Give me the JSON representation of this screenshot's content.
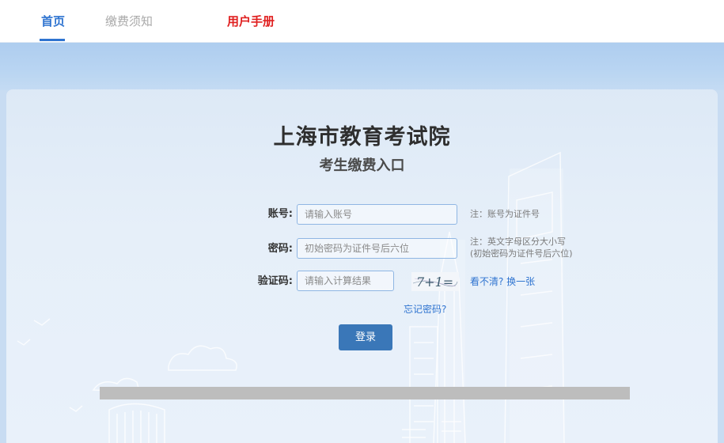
{
  "nav": {
    "items": [
      {
        "label": "首页",
        "active": true
      },
      {
        "label": "缴费须知",
        "active": false
      },
      {
        "label": "用户手册",
        "active": false
      }
    ]
  },
  "header": {
    "title": "上海市教育考试院",
    "subtitle": "考生缴费入口"
  },
  "form": {
    "account": {
      "label": "账号:",
      "placeholder": "请输入账号",
      "note": "注：账号为证件号"
    },
    "password": {
      "label": "密码:",
      "placeholder": "初始密码为证件号后六位",
      "note_line1": "注：英文字母区分大小写",
      "note_line2": "(初始密码为证件号后六位)"
    },
    "captcha": {
      "label": "验证码:",
      "placeholder": "请输入计算结果",
      "image_text": "7+1=",
      "refresh_link": "看不清? 换一张"
    },
    "forgot_link": "忘记密码?",
    "submit_label": "登录"
  },
  "colors": {
    "accent": "#2f74d0",
    "manual": "#e02020",
    "button": "#3a77b8"
  }
}
